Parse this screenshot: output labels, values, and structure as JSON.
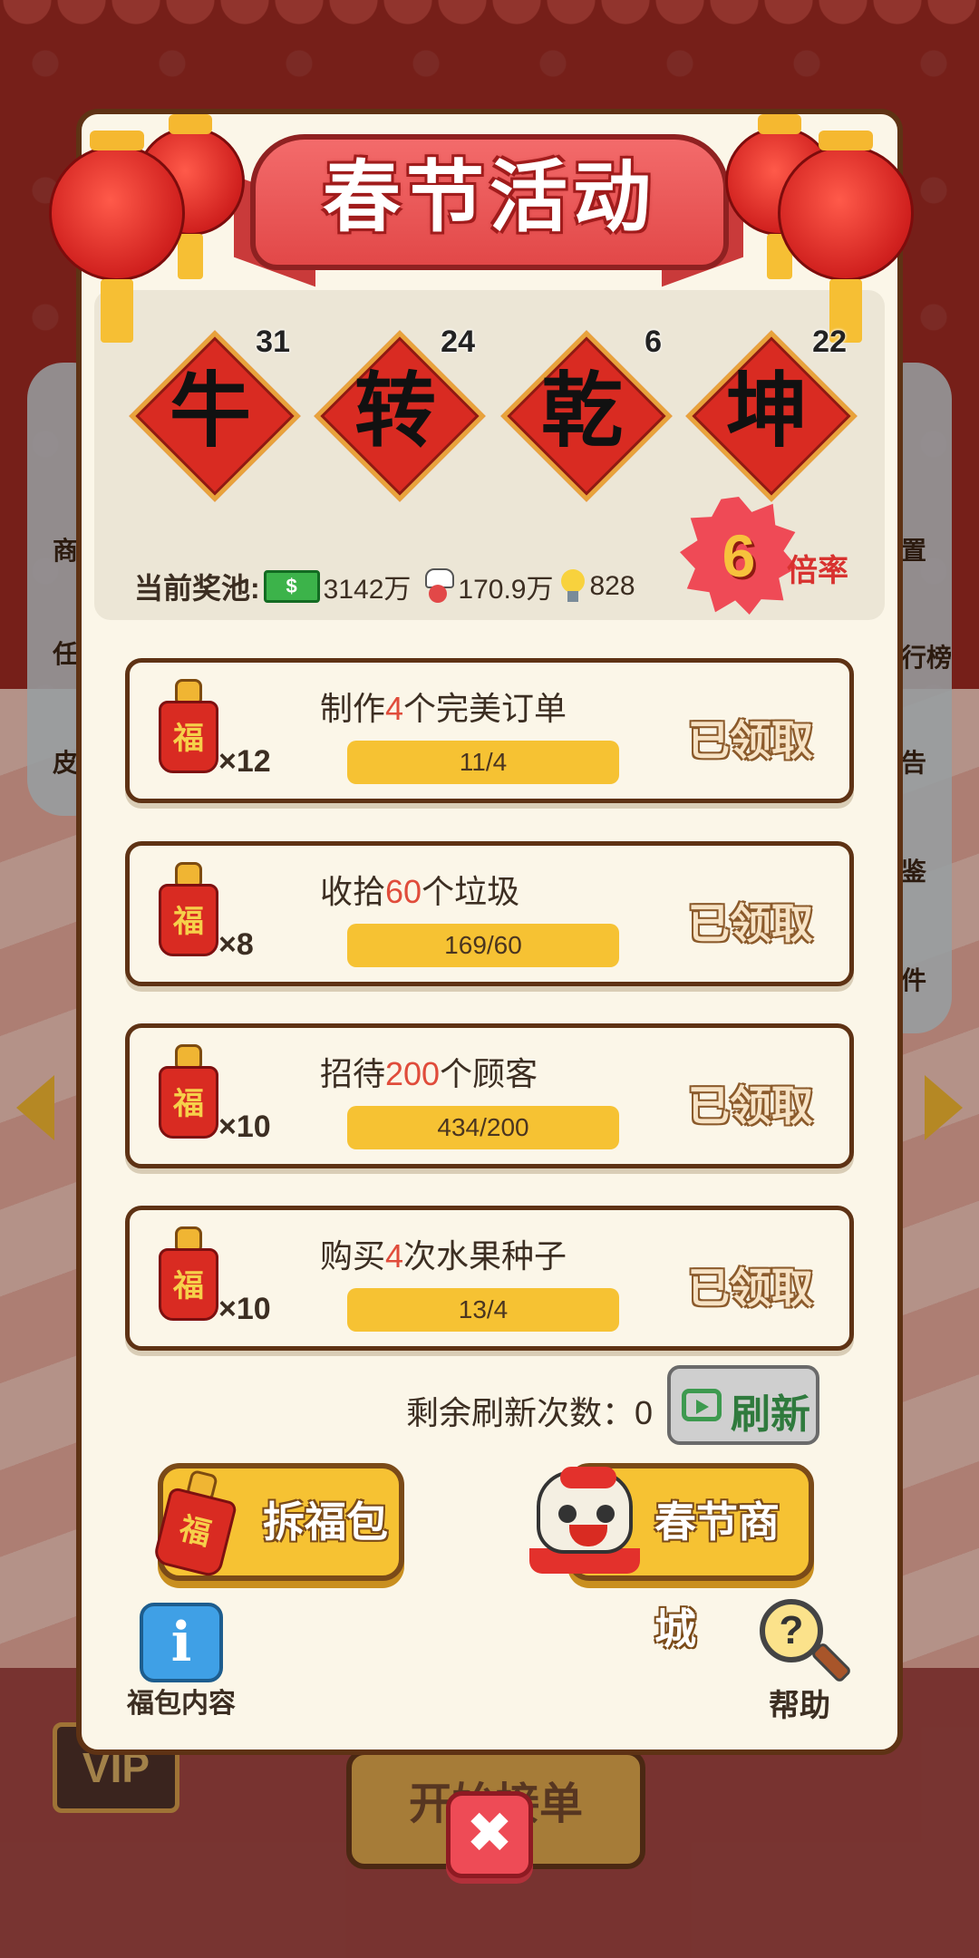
{
  "background": {
    "left_labels": [
      "商",
      "任",
      "皮"
    ],
    "right_labels": [
      "置",
      "行榜",
      "告",
      "鉴",
      "件"
    ],
    "start_order": "开始接单",
    "vip": "VIP"
  },
  "event": {
    "title": "春节活动",
    "characters": [
      {
        "char": "牛",
        "count": "31"
      },
      {
        "char": "转",
        "count": "24"
      },
      {
        "char": "乾",
        "count": "6"
      },
      {
        "char": "坤",
        "count": "22"
      }
    ],
    "pool": {
      "label": "当前奖池:",
      "money_icon": "$",
      "money": "3142万",
      "chef": "170.9万",
      "bulbs": "828"
    },
    "multiplier": {
      "value": "6",
      "label": "倍率"
    }
  },
  "tasks": [
    {
      "pre": "制作",
      "num": "4",
      "post": "个完美订单",
      "reward_char": "福",
      "reward": "×12",
      "progress": "11/4",
      "status": "已领取"
    },
    {
      "pre": "收拾",
      "num": "60",
      "post": "个垃圾",
      "reward_char": "福",
      "reward": "×8",
      "progress": "169/60",
      "status": "已领取"
    },
    {
      "pre": "招待",
      "num": "200",
      "post": "个顾客",
      "reward_char": "福",
      "reward": "×10",
      "progress": "434/200",
      "status": "已领取"
    },
    {
      "pre": "购买",
      "num": "4",
      "post": "次水果种子",
      "reward_char": "福",
      "reward": "×10",
      "progress": "13/4",
      "status": "已领取"
    }
  ],
  "refresh": {
    "remaining_text": "剩余刷新次数：0",
    "button": "刷新"
  },
  "buttons": {
    "open_bag": "拆福包",
    "open_bag_char": "福",
    "shop": "春节商城",
    "info_icon": "i",
    "info_label": "福包内容",
    "help_icon": "?",
    "help_label": "帮助",
    "close_icon": "✖"
  },
  "colors": {
    "accent_red": "#d92b22",
    "gold": "#f6c233",
    "border_brown": "#5e3214",
    "highlight": "#e04c3b"
  }
}
